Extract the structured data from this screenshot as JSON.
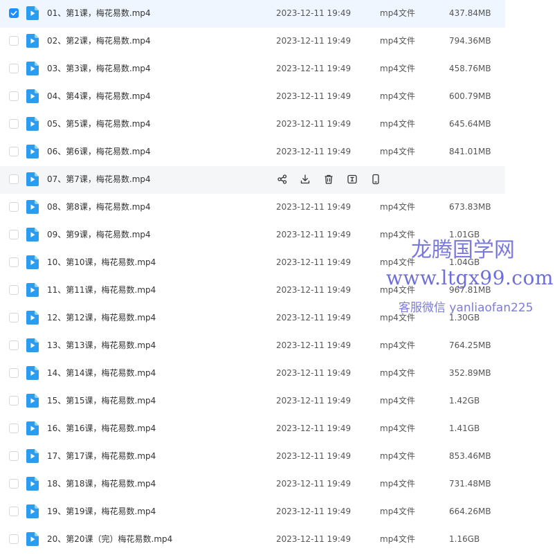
{
  "files": [
    {
      "name": "01、第1课，梅花易数.mp4",
      "date": "2023-12-11 19:49",
      "type": "mp4文件",
      "size": "437.84MB",
      "selected": true,
      "hovered": false
    },
    {
      "name": "02、第2课，梅花易数.mp4",
      "date": "2023-12-11 19:49",
      "type": "mp4文件",
      "size": "794.36MB",
      "selected": false,
      "hovered": false
    },
    {
      "name": "03、第3课，梅花易数.mp4",
      "date": "2023-12-11 19:49",
      "type": "mp4文件",
      "size": "458.76MB",
      "selected": false,
      "hovered": false
    },
    {
      "name": "04、第4课，梅花易数.mp4",
      "date": "2023-12-11 19:49",
      "type": "mp4文件",
      "size": "600.79MB",
      "selected": false,
      "hovered": false
    },
    {
      "name": "05、第5课，梅花易数.mp4",
      "date": "2023-12-11 19:49",
      "type": "mp4文件",
      "size": "645.64MB",
      "selected": false,
      "hovered": false
    },
    {
      "name": "06、第6课，梅花易数.mp4",
      "date": "2023-12-11 19:49",
      "type": "mp4文件",
      "size": "841.01MB",
      "selected": false,
      "hovered": false
    },
    {
      "name": "07、第7课，梅花易数.mp4",
      "date": "",
      "type": "",
      "size": "",
      "selected": false,
      "hovered": true
    },
    {
      "name": "08、第8课，梅花易数.mp4",
      "date": "2023-12-11 19:49",
      "type": "mp4文件",
      "size": "673.83MB",
      "selected": false,
      "hovered": false
    },
    {
      "name": "09、第9课，梅花易数.mp4",
      "date": "2023-12-11 19:49",
      "type": "mp4文件",
      "size": "1.01GB",
      "selected": false,
      "hovered": false
    },
    {
      "name": "10、第10课，梅花易数.mp4",
      "date": "2023-12-11 19:49",
      "type": "mp4文件",
      "size": "1.04GB",
      "selected": false,
      "hovered": false
    },
    {
      "name": "11、第11课，梅花易数.mp4",
      "date": "2023-12-11 19:49",
      "type": "mp4文件",
      "size": "967.81MB",
      "selected": false,
      "hovered": false
    },
    {
      "name": "12、第12课，梅花易数.mp4",
      "date": "2023-12-11 19:49",
      "type": "mp4文件",
      "size": "1.30GB",
      "selected": false,
      "hovered": false
    },
    {
      "name": "13、第13课，梅花易数.mp4",
      "date": "2023-12-11 19:49",
      "type": "mp4文件",
      "size": "764.25MB",
      "selected": false,
      "hovered": false
    },
    {
      "name": "14、第14课，梅花易数.mp4",
      "date": "2023-12-11 19:49",
      "type": "mp4文件",
      "size": "352.89MB",
      "selected": false,
      "hovered": false
    },
    {
      "name": "15、第15课，梅花易数.mp4",
      "date": "2023-12-11 19:49",
      "type": "mp4文件",
      "size": "1.42GB",
      "selected": false,
      "hovered": false
    },
    {
      "name": "16、第16课，梅花易数.mp4",
      "date": "2023-12-11 19:49",
      "type": "mp4文件",
      "size": "1.41GB",
      "selected": false,
      "hovered": false
    },
    {
      "name": "17、第17课，梅花易数.mp4",
      "date": "2023-12-11 19:49",
      "type": "mp4文件",
      "size": "853.46MB",
      "selected": false,
      "hovered": false
    },
    {
      "name": "18、第18课，梅花易数.mp4",
      "date": "2023-12-11 19:49",
      "type": "mp4文件",
      "size": "731.48MB",
      "selected": false,
      "hovered": false
    },
    {
      "name": "19、第19课，梅花易数.mp4",
      "date": "2023-12-11 19:49",
      "type": "mp4文件",
      "size": "664.26MB",
      "selected": false,
      "hovered": false
    },
    {
      "name": "20、第20课（完）梅花易数.mp4",
      "date": "2023-12-11 19:49",
      "type": "mp4文件",
      "size": "1.16GB",
      "selected": false,
      "hovered": false
    }
  ],
  "row_actions": [
    {
      "name": "share-icon"
    },
    {
      "name": "download-icon"
    },
    {
      "name": "delete-icon"
    },
    {
      "name": "rename-icon"
    },
    {
      "name": "mobile-icon"
    }
  ],
  "watermark": {
    "title": "龙腾国学网",
    "url": "www.ltgx99.com",
    "contact": "客服微信 yanliaofan225"
  },
  "colors": {
    "accent": "#1f8fff",
    "file_icon": "#2b9df0",
    "selected_row": "#f0f6ff",
    "hover_row": "#f5f6f8",
    "watermark": "#6c6cd9"
  }
}
